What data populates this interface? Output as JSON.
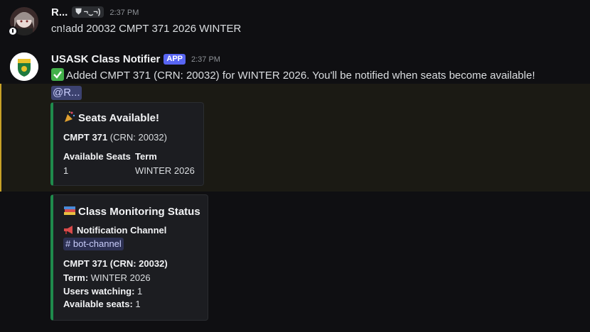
{
  "messages": [
    {
      "username": "R...",
      "clan_tag": "⛊ ¬‿¬)",
      "timestamp": "2:37 PM",
      "text": "cn!add 20032 CMPT 371 2026 WINTER"
    },
    {
      "username": "USASK Class Notifier",
      "badge": "APP",
      "timestamp": "2:37 PM",
      "text": "Added CMPT 371 (CRN: 20032) for WINTER 2026. You'll be notified when seats become available!",
      "mention": "@R..."
    }
  ],
  "seats_embed": {
    "title": "Seats Available!",
    "course": "CMPT 371",
    "crn": "(CRN: 20032)",
    "fields": [
      {
        "name": "Available Seats",
        "value": "1"
      },
      {
        "name": "Term",
        "value": "WINTER 2026"
      }
    ]
  },
  "status_embed": {
    "title": "Class Monitoring Status",
    "channel_field": "Notification Channel",
    "channel": "bot-channel",
    "course_line": "CMPT 371 (CRN: 20032)",
    "term_label": "Term:",
    "term_value": "WINTER 2026",
    "watching_label": "Users watching:",
    "watching_value": "1",
    "seats_label": "Available seats:",
    "seats_value": "1"
  },
  "colors": {
    "embed_accent": "#1f8b4c",
    "app_badge": "#5865f2",
    "mention_bg": "#3c4270",
    "highlight_border": "#c9a227"
  },
  "icons": [
    "user-avatar",
    "bot-avatar-shield",
    "check-mark-icon",
    "party-popper-icon",
    "books-icon",
    "megaphone-icon",
    "hash-icon"
  ]
}
